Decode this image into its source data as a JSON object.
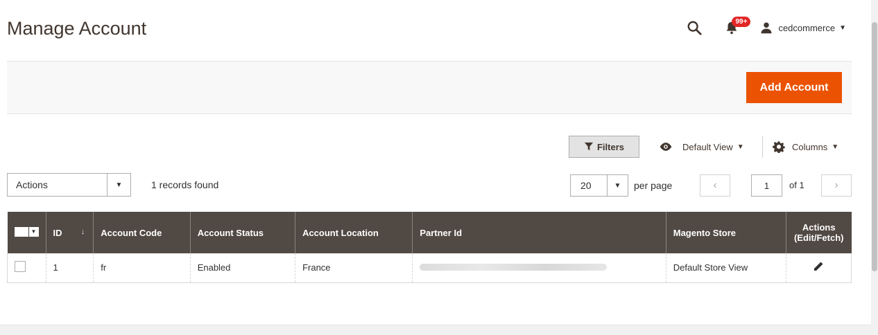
{
  "header": {
    "title": "Manage Account",
    "notification_count": "99+",
    "username": "cedcommerce"
  },
  "action_bar": {
    "add_account_label": "Add Account"
  },
  "toolbar": {
    "filters_label": "Filters",
    "view_label": "Default View",
    "columns_label": "Columns",
    "mass_actions_label": "Actions",
    "records_found": "1 records found",
    "per_page_value": "20",
    "per_page_label": "per page",
    "current_page": "1",
    "page_total": "of 1"
  },
  "grid": {
    "columns": [
      {
        "key": "id",
        "label": "ID"
      },
      {
        "key": "account_code",
        "label": "Account Code"
      },
      {
        "key": "account_status",
        "label": "Account Status"
      },
      {
        "key": "account_location",
        "label": "Account Location"
      },
      {
        "key": "partner_id",
        "label": "Partner Id"
      },
      {
        "key": "magento_store",
        "label": "Magento Store"
      },
      {
        "key": "actions",
        "label": "Actions (Edit/Fetch)"
      }
    ],
    "rows": [
      {
        "id": "1",
        "account_code": "fr",
        "account_status": "Enabled",
        "account_location": "France",
        "magento_store": "Default Store View"
      }
    ]
  },
  "icons": {
    "search": "search-icon",
    "notification": "bell-icon",
    "user": "user-icon",
    "filter": "filter-icon",
    "view": "eye-icon",
    "columns": "gear-icon",
    "edit": "pencil-icon"
  },
  "colors": {
    "primary_button": "#eb5202",
    "grid_header": "#514943",
    "badge": "#e22626"
  }
}
